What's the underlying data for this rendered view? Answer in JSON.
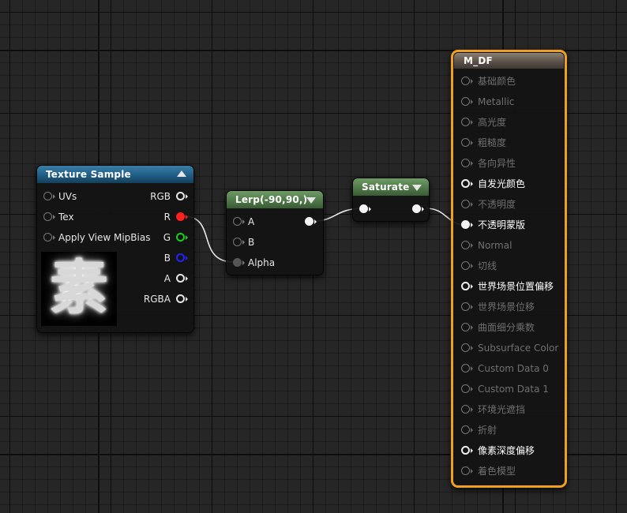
{
  "texture_sample": {
    "title": "Texture Sample",
    "inputs": [
      "UVs",
      "Tex",
      "Apply View MipBias"
    ],
    "outputs": [
      "RGB",
      "R",
      "G",
      "B",
      "A",
      "RGBA"
    ],
    "output_pin_colors": [
      "#e6e6e6",
      "#ff2020",
      "#19d119",
      "#2323ff",
      "#e6e6e6",
      "#e6e6e6"
    ],
    "preview_glyph": "素"
  },
  "lerp": {
    "title": "Lerp(-90,90,)",
    "inputs": [
      "A",
      "B",
      "Alpha"
    ]
  },
  "saturate": {
    "title": "Saturate"
  },
  "material": {
    "title": "M_DF",
    "inputs": [
      {
        "label": "基础颜色",
        "active": false,
        "connected": false
      },
      {
        "label": "Metallic",
        "active": false,
        "connected": false
      },
      {
        "label": "高光度",
        "active": false,
        "connected": false
      },
      {
        "label": "粗糙度",
        "active": false,
        "connected": false
      },
      {
        "label": "各向异性",
        "active": false,
        "connected": false
      },
      {
        "label": "自发光颜色",
        "active": true,
        "connected": false
      },
      {
        "label": "不透明度",
        "active": false,
        "connected": false
      },
      {
        "label": "不透明蒙版",
        "active": true,
        "connected": true
      },
      {
        "label": "Normal",
        "active": false,
        "connected": false
      },
      {
        "label": "切线",
        "active": false,
        "connected": false
      },
      {
        "label": "世界场景位置偏移",
        "active": true,
        "connected": false
      },
      {
        "label": "世界场景位移",
        "active": false,
        "connected": false
      },
      {
        "label": "曲面细分乘数",
        "active": false,
        "connected": false
      },
      {
        "label": "Subsurface Color",
        "active": false,
        "connected": false
      },
      {
        "label": "Custom Data 0",
        "active": false,
        "connected": false
      },
      {
        "label": "Custom Data 1",
        "active": false,
        "connected": false
      },
      {
        "label": "环境光遮挡",
        "active": false,
        "connected": false
      },
      {
        "label": "折射",
        "active": false,
        "connected": false
      },
      {
        "label": "像素深度偏移",
        "active": true,
        "connected": false
      },
      {
        "label": "着色模型",
        "active": false,
        "connected": false
      }
    ],
    "selection_color": "#f0a020"
  },
  "colors": {
    "background": "#262626",
    "wire": "#e8e8e8"
  }
}
